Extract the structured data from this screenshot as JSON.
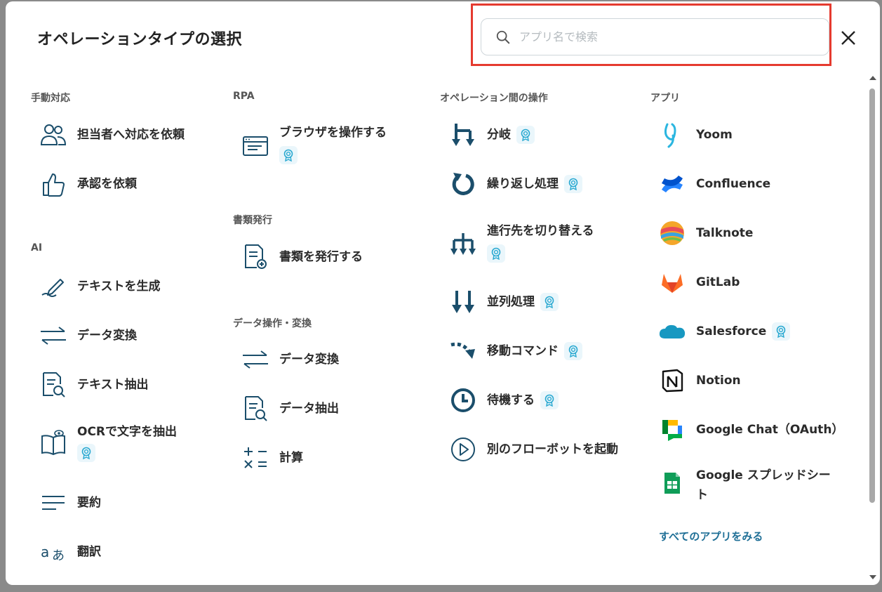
{
  "title": "オペレーションタイプの選択",
  "search": {
    "placeholder": "アプリ名で検索"
  },
  "columns": {
    "manual": {
      "heading": "手動対応",
      "items": [
        "担当者へ対応を依頼",
        "承認を依頼"
      ]
    },
    "ai": {
      "heading": "AI",
      "items": [
        "テキストを生成",
        "データ変換",
        "テキスト抽出",
        "OCRで文字を抽出",
        "要約",
        "翻訳"
      ]
    },
    "rpa": {
      "heading": "RPA",
      "items": [
        "ブラウザを操作する"
      ]
    },
    "docs": {
      "heading": "書類発行",
      "items": [
        "書類を発行する"
      ]
    },
    "data": {
      "heading": "データ操作・変換",
      "items": [
        "データ変換",
        "データ抽出",
        "計算"
      ]
    },
    "ops": {
      "heading": "オペレーション間の操作",
      "items": [
        "分岐",
        "繰り返し処理",
        "進行先を切り替える",
        "並列処理",
        "移動コマンド",
        "待機する",
        "別のフローボットを起動"
      ]
    },
    "apps": {
      "heading": "アプリ",
      "items": [
        "Yoom",
        "Confluence",
        "Talknote",
        "GitLab",
        "Salesforce",
        "Notion",
        "Google Chat（OAuth）",
        "Google スプレッドシー",
        "ト"
      ],
      "see_all": "すべてのアプリをみる"
    }
  },
  "colors": {
    "accent": "#1f6f96",
    "icon": "#1b4e6b",
    "highlight": "#e53a2f",
    "badge_bg": "#eaf6fb",
    "badge_fg": "#2aa9d1"
  }
}
